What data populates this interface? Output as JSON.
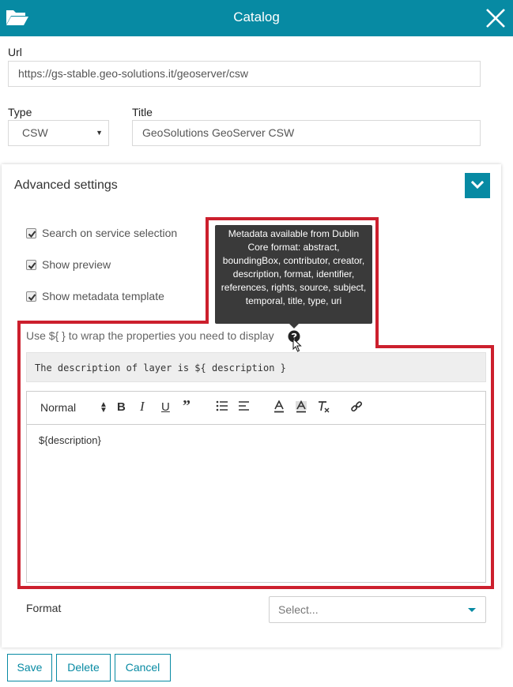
{
  "header": {
    "title": "Catalog",
    "folder_icon": "folder-open-icon",
    "close_icon": "close-icon",
    "color": "#078aa3"
  },
  "url": {
    "label": "Url",
    "value": "https://gs-stable.geo-solutions.it/geoserver/csw"
  },
  "type": {
    "label": "Type",
    "value": "CSW"
  },
  "title_field": {
    "label": "Title",
    "value": "GeoSolutions GeoServer CSW"
  },
  "advanced": {
    "title": "Advanced settings",
    "toggle_icon": "chevron-down-icon",
    "checkboxes": [
      {
        "label": "Search on service selection",
        "checked": true
      },
      {
        "label": "Show preview",
        "checked": true
      },
      {
        "label": "Show metadata template",
        "checked": true
      }
    ],
    "tooltip": "Metadata available from Dublin Core format: abstract, boundingBox, contributor, creator, description, format, identifier, references, rights, source, subject, temporal, title, type, uri",
    "hint": "Use ${ } to wrap the properties you need to display",
    "help_icon": "question-circle-icon",
    "code_example": "The description of layer is ${ description }",
    "editor": {
      "format_select": "Normal",
      "tools": [
        "bold-icon",
        "italic-icon",
        "underline-icon",
        "blockquote-icon",
        "bullet-list-icon",
        "align-icon",
        "font-color-icon",
        "background-color-icon",
        "clear-format-icon",
        "link-icon"
      ],
      "content": "${description}"
    },
    "format": {
      "label": "Format",
      "placeholder": "Select..."
    },
    "highlight_color": "#cc1f2d"
  },
  "buttons": {
    "save": "Save",
    "delete": "Delete",
    "cancel": "Cancel"
  }
}
